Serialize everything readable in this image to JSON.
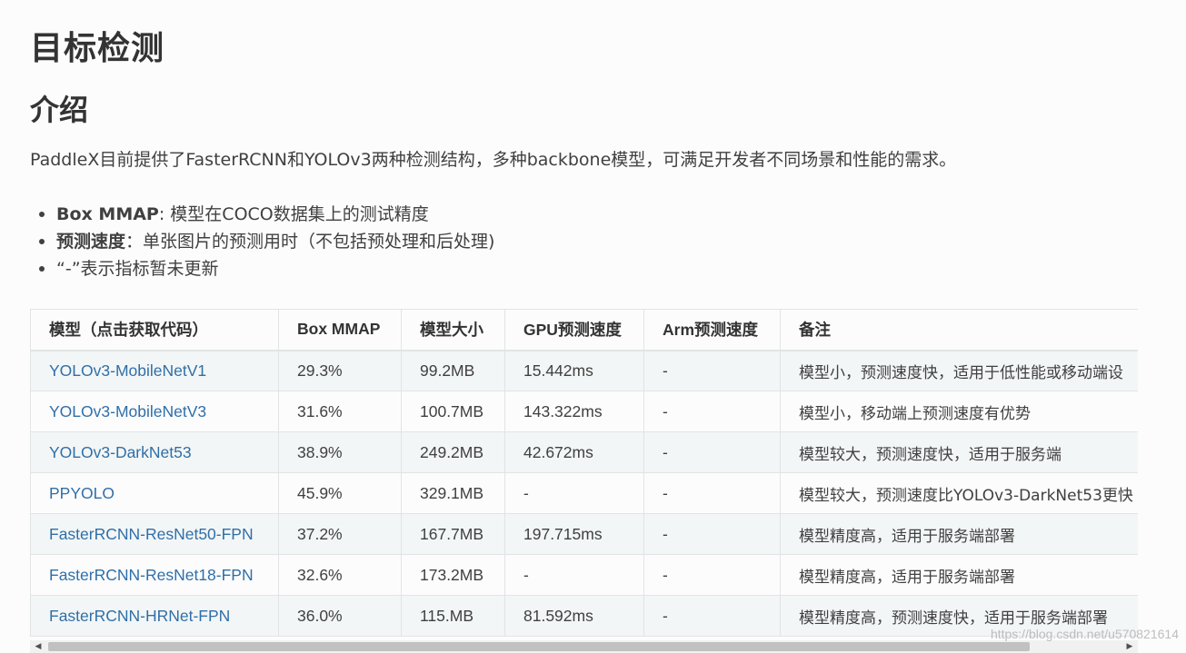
{
  "title": "目标检测",
  "section_title": "介绍",
  "intro": "PaddleX目前提供了FasterRCNN和YOLOv3两种检测结构，多种backbone模型，可满足开发者不同场景和性能的需求。",
  "notes": [
    {
      "label": "Box MMAP",
      "text": ": 模型在COCO数据集上的测试精度"
    },
    {
      "label": "预测速度",
      "text": "：单张图片的预测用时（不包括预处理和后处理)"
    },
    {
      "label": "",
      "text": "“-”表示指标暂未更新"
    }
  ],
  "table": {
    "headers": [
      "模型（点击获取代码）",
      "Box MMAP",
      "模型大小",
      "GPU预测速度",
      "Arm预测速度",
      "备注"
    ],
    "rows": [
      [
        "YOLOv3-MobileNetV1",
        "29.3%",
        "99.2MB",
        "15.442ms",
        "-",
        "模型小，预测速度快，适用于低性能或移动端设"
      ],
      [
        "YOLOv3-MobileNetV3",
        "31.6%",
        "100.7MB",
        "143.322ms",
        "-",
        "模型小，移动端上预测速度有优势"
      ],
      [
        "YOLOv3-DarkNet53",
        "38.9%",
        "249.2MB",
        "42.672ms",
        "-",
        "模型较大，预测速度快，适用于服务端"
      ],
      [
        "PPYOLO",
        "45.9%",
        "329.1MB",
        "-",
        "-",
        "模型较大，预测速度比YOLOv3-DarkNet53更快"
      ],
      [
        "FasterRCNN-ResNet50-FPN",
        "37.2%",
        "167.7MB",
        "197.715ms",
        "-",
        "模型精度高，适用于服务端部署"
      ],
      [
        "FasterRCNN-ResNet18-FPN",
        "32.6%",
        "173.2MB",
        "-",
        "-",
        "模型精度高，适用于服务端部署"
      ],
      [
        "FasterRCNN-HRNet-FPN",
        "36.0%",
        "115.MB",
        "81.592ms",
        "-",
        "模型精度高，预测速度快，适用于服务端部署"
      ]
    ]
  },
  "scrollbar": {
    "left_arrow": "◀",
    "right_arrow": "▶"
  },
  "watermark": "https://blog.csdn.net/u570821614"
}
